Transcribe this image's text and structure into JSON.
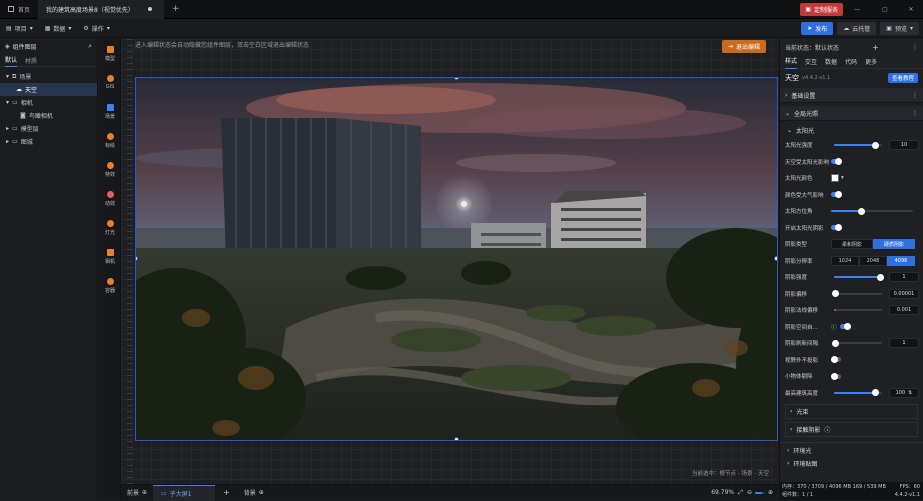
{
  "titlebar": {
    "home_tab": "首页",
    "project_tab": "我的建筑高度场景8（视觉优先）",
    "user_label": "定制服务"
  },
  "menubar": {
    "project": "项目",
    "data": "数据",
    "operations": "操作",
    "publish": "发布",
    "cloud_render": "云托管",
    "preview": "预览"
  },
  "left_panel": {
    "title": "组件图层",
    "tabs": [
      "默认",
      "材质"
    ],
    "tree": [
      {
        "label": "场景",
        "indent": 0
      },
      {
        "label": "天空",
        "indent": 1
      },
      {
        "label": "相机",
        "indent": 0
      },
      {
        "label": "鸟瞰相机",
        "indent": 2
      },
      {
        "label": "模型层",
        "indent": 0
      },
      {
        "label": "图城",
        "indent": 0
      }
    ]
  },
  "tools": [
    {
      "label": "模型"
    },
    {
      "label": "GIS"
    },
    {
      "label": "场景"
    },
    {
      "label": "标绘"
    },
    {
      "label": "特效"
    },
    {
      "label": "动效"
    },
    {
      "label": "灯光"
    },
    {
      "label": "相机"
    },
    {
      "label": "容器"
    }
  ],
  "viewport": {
    "hint": "进入编辑状态会自动隐藏您组件图层，双击空白区域退出编辑状态",
    "exit_edit": "退出编辑",
    "breadcrumb": "当前选中：根节点 - 场景 - 天空"
  },
  "bottom": {
    "front": "前景",
    "subpage": "子大屏1",
    "back": "背景",
    "zoom": "69.79%"
  },
  "right_panel": {
    "status": "当前状态：默认状态",
    "tabs": [
      "样式",
      "交互",
      "数据",
      "代码",
      "更多"
    ],
    "component_name": "天空",
    "component_version": "v4.4.2-v1.1",
    "tutorial": "查看教程",
    "sections": {
      "basic": "基础设置",
      "global_light": "全局光照",
      "sunlight": "太阳光",
      "beam": "光束",
      "contact_shadow": "接触阴影",
      "ambient": "环境光",
      "env_map": "环境贴图"
    },
    "props": {
      "sun_intensity": {
        "label": "太阳光强度",
        "value": "10",
        "level": 0.82
      },
      "sky_affect": {
        "label": "天空受太阳光影响",
        "on": true
      },
      "sun_color": {
        "label": "太阳光颜色",
        "value": "#ffffff"
      },
      "atmosphere_affect": {
        "label": "颜色受大气影响",
        "on": true
      },
      "sun_azimuth": {
        "label": "太阳方位角",
        "level": 0.36
      },
      "sun_shadow": {
        "label": "开启太阳光阴影",
        "on": true
      },
      "shadow_type": {
        "label": "阴影类型",
        "options": [
          "柔和阴影",
          "硬质阴影"
        ],
        "selected": 1
      },
      "shadow_res": {
        "label": "阴影分辨率",
        "options": [
          "1024",
          "2048",
          "4096"
        ],
        "selected": 2
      },
      "shadow_strength": {
        "label": "阴影强度",
        "value": "1",
        "level": 0.95
      },
      "shadow_bias": {
        "label": "阴影偏移",
        "value": "0.00001",
        "level": 0.02
      },
      "shadow_normal_bias": {
        "label": "阴影法线偏移",
        "value": "0.001",
        "level": 0.05
      },
      "shadow_space": {
        "label": "阴影空间自...",
        "on": true
      },
      "shadow_refresh": {
        "label": "阴影刷新间隔",
        "value": "1",
        "level": 0.02
      },
      "invisible_shadow": {
        "label": "视野外不投影",
        "on": false
      },
      "small_object": {
        "label": "小物体剔除",
        "on": false
      },
      "tall_building": {
        "label": "最高建筑高度",
        "value": "100",
        "level": 0.82
      }
    },
    "footer": {
      "memory": "内存：370 / 3709 / 4096 MB   169 / 539 MB",
      "fps": "FPS：60",
      "components": "组件数：1 / 1",
      "version": "4.4.2-v1.1"
    }
  }
}
